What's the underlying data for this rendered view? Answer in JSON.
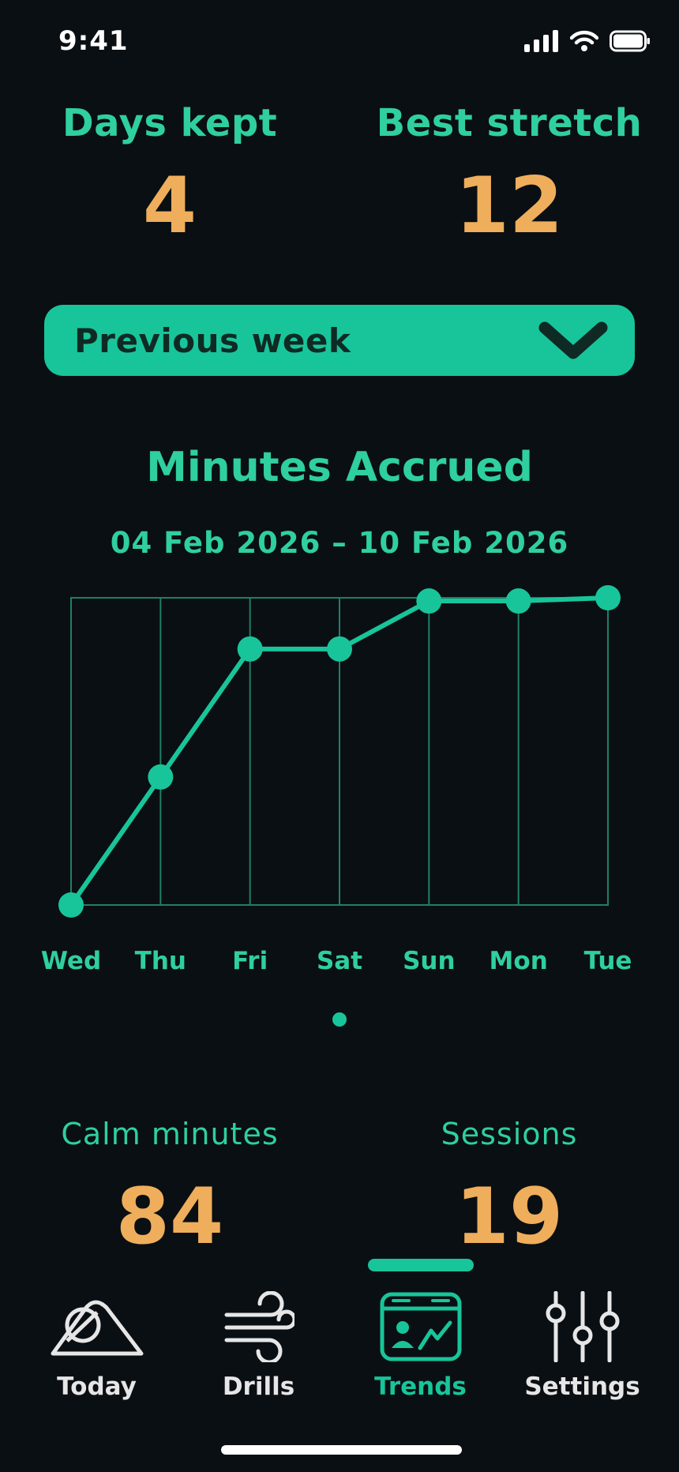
{
  "status": {
    "time": "9:41"
  },
  "streak": {
    "days_kept": {
      "label": "Days kept",
      "value": "4"
    },
    "best_stretch": {
      "label": "Best stretch",
      "value": "12"
    }
  },
  "period_selector": {
    "selected": "Previous week"
  },
  "chart_data": {
    "type": "line",
    "title": "Minutes Accrued",
    "subtitle": "04 Feb 2026 – 10 Feb 2026",
    "categories": [
      "Wed",
      "Thu",
      "Fri",
      "Sat",
      "Sun",
      "Mon",
      "Tue"
    ],
    "values": [
      0,
      40,
      80,
      80,
      95,
      95,
      96
    ],
    "ylim": [
      0,
      96
    ],
    "grid": "vertical",
    "accent": "#18c59a"
  },
  "pager": {
    "pages": 1,
    "active": 0
  },
  "totals": {
    "calm_minutes": {
      "label": "Calm minutes",
      "value": "84"
    },
    "sessions": {
      "label": "Sessions",
      "value": "19"
    }
  },
  "tabs": [
    {
      "label": "Today",
      "icon": "mountain-icon"
    },
    {
      "label": "Drills",
      "icon": "wind-icon"
    },
    {
      "label": "Trends",
      "icon": "trends-calendar-icon",
      "active": true
    },
    {
      "label": "Settings",
      "icon": "sliders-icon"
    }
  ],
  "colors": {
    "background": "#0a0f13",
    "accent": "#18c59a",
    "text_accent": "#2fcf9f",
    "value": "#efae5b"
  }
}
